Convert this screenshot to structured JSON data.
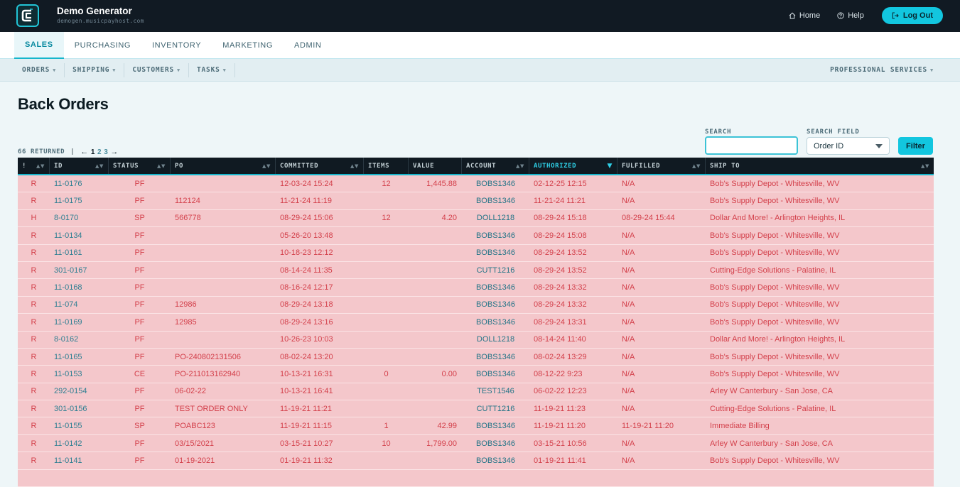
{
  "app": {
    "name": "Demo Generator",
    "host": "demogen.musicpayhost.com"
  },
  "topnav": {
    "home": "Home",
    "help": "Help",
    "logout": "Log Out"
  },
  "main_tabs": [
    "SALES",
    "PURCHASING",
    "INVENTORY",
    "MARKETING",
    "ADMIN"
  ],
  "active_tab": "SALES",
  "sub_nav": [
    "ORDERS",
    "SHIPPING",
    "CUSTOMERS",
    "TASKS"
  ],
  "sub_nav_right": "PROFESSIONAL SERVICES",
  "page_title": "Back Orders",
  "results": {
    "returned": "66 RETURNED",
    "pages": [
      "1",
      "2",
      "3"
    ],
    "current_page": "1"
  },
  "search": {
    "label": "SEARCH",
    "value": "",
    "field_label": "SEARCH FIELD",
    "field_value": "Order ID",
    "filter_button": "Filter"
  },
  "columns": [
    "!",
    "ID",
    "STATUS",
    "PO",
    "COMMITTED",
    "ITEMS",
    "VALUE",
    "ACCOUNT",
    "AUTHORIZED",
    "FULFILLED",
    "SHIP TO"
  ],
  "sorted_column": "AUTHORIZED",
  "colors": {
    "accent": "#12c6df",
    "row_bg": "#f4c7cb",
    "row_text": "#d3404b",
    "header_bg": "#101a22"
  },
  "rows": [
    {
      "flag": "R",
      "id": "11-0176",
      "status": "PF",
      "po": "",
      "committed": "12-03-24 15:24",
      "items": "12",
      "value": "1,445.88",
      "account": "BOBS1346",
      "authorized": "02-12-25 12:15",
      "fulfilled": "N/A",
      "ship_to": "Bob's Supply Depot - Whitesville, WV"
    },
    {
      "flag": "R",
      "id": "11-0175",
      "status": "PF",
      "po": "112124",
      "committed": "11-21-24 11:19",
      "items": "",
      "value": "",
      "account": "BOBS1346",
      "authorized": "11-21-24 11:21",
      "fulfilled": "N/A",
      "ship_to": "Bob's Supply Depot - Whitesville, WV"
    },
    {
      "flag": "H",
      "id": "8-0170",
      "status": "SP",
      "po": "566778",
      "committed": "08-29-24 15:06",
      "items": "12",
      "value": "4.20",
      "account": "DOLL1218",
      "authorized": "08-29-24 15:18",
      "fulfilled": "08-29-24 15:44",
      "ship_to": "Dollar And More! - Arlington Heights, IL"
    },
    {
      "flag": "R",
      "id": "11-0134",
      "status": "PF",
      "po": "",
      "committed": "05-26-20 13:48",
      "items": "",
      "value": "",
      "account": "BOBS1346",
      "authorized": "08-29-24 15:08",
      "fulfilled": "N/A",
      "ship_to": "Bob's Supply Depot - Whitesville, WV"
    },
    {
      "flag": "R",
      "id": "11-0161",
      "status": "PF",
      "po": "",
      "committed": "10-18-23 12:12",
      "items": "",
      "value": "",
      "account": "BOBS1346",
      "authorized": "08-29-24 13:52",
      "fulfilled": "N/A",
      "ship_to": "Bob's Supply Depot - Whitesville, WV"
    },
    {
      "flag": "R",
      "id": "301-0167",
      "status": "PF",
      "po": "",
      "committed": "08-14-24 11:35",
      "items": "",
      "value": "",
      "account": "CUTT1216",
      "authorized": "08-29-24 13:52",
      "fulfilled": "N/A",
      "ship_to": "Cutting-Edge Solutions - Palatine, IL"
    },
    {
      "flag": "R",
      "id": "11-0168",
      "status": "PF",
      "po": "",
      "committed": "08-16-24 12:17",
      "items": "",
      "value": "",
      "account": "BOBS1346",
      "authorized": "08-29-24 13:32",
      "fulfilled": "N/A",
      "ship_to": "Bob's Supply Depot - Whitesville, WV"
    },
    {
      "flag": "R",
      "id": "11-074",
      "status": "PF",
      "po": "12986",
      "committed": "08-29-24 13:18",
      "items": "",
      "value": "",
      "account": "BOBS1346",
      "authorized": "08-29-24 13:32",
      "fulfilled": "N/A",
      "ship_to": "Bob's Supply Depot - Whitesville, WV"
    },
    {
      "flag": "R",
      "id": "11-0169",
      "status": "PF",
      "po": "12985",
      "committed": "08-29-24 13:16",
      "items": "",
      "value": "",
      "account": "BOBS1346",
      "authorized": "08-29-24 13:31",
      "fulfilled": "N/A",
      "ship_to": "Bob's Supply Depot - Whitesville, WV"
    },
    {
      "flag": "R",
      "id": "8-0162",
      "status": "PF",
      "po": "",
      "committed": "10-26-23 10:03",
      "items": "",
      "value": "",
      "account": "DOLL1218",
      "authorized": "08-14-24 11:40",
      "fulfilled": "N/A",
      "ship_to": "Dollar And More! - Arlington Heights, IL"
    },
    {
      "flag": "R",
      "id": "11-0165",
      "status": "PF",
      "po": "PO-240802131506",
      "committed": "08-02-24 13:20",
      "items": "",
      "value": "",
      "account": "BOBS1346",
      "authorized": "08-02-24 13:29",
      "fulfilled": "N/A",
      "ship_to": "Bob's Supply Depot - Whitesville, WV"
    },
    {
      "flag": "R",
      "id": "11-0153",
      "status": "CE",
      "po": "PO-211013162940",
      "committed": "10-13-21 16:31",
      "items": "0",
      "value": "0.00",
      "account": "BOBS1346",
      "authorized": "08-12-22 9:23",
      "fulfilled": "N/A",
      "ship_to": "Bob's Supply Depot - Whitesville, WV"
    },
    {
      "flag": "R",
      "id": "292-0154",
      "status": "PF",
      "po": "06-02-22",
      "committed": "10-13-21 16:41",
      "items": "",
      "value": "",
      "account": "TEST1546",
      "authorized": "06-02-22 12:23",
      "fulfilled": "N/A",
      "ship_to": "Arley W Canterbury - San Jose, CA"
    },
    {
      "flag": "R",
      "id": "301-0156",
      "status": "PF",
      "po": "TEST ORDER ONLY",
      "committed": "11-19-21 11:21",
      "items": "",
      "value": "",
      "account": "CUTT1216",
      "authorized": "11-19-21 11:23",
      "fulfilled": "N/A",
      "ship_to": "Cutting-Edge Solutions - Palatine, IL"
    },
    {
      "flag": "R",
      "id": "11-0155",
      "status": "SP",
      "po": "POABC123",
      "committed": "11-19-21 11:15",
      "items": "1",
      "value": "42.99",
      "account": "BOBS1346",
      "authorized": "11-19-21 11:20",
      "fulfilled": "11-19-21 11:20",
      "ship_to": "Immediate Billing"
    },
    {
      "flag": "R",
      "id": "11-0142",
      "status": "PF",
      "po": "03/15/2021",
      "committed": "03-15-21 10:27",
      "items": "10",
      "value": "1,799.00",
      "account": "BOBS1346",
      "authorized": "03-15-21 10:56",
      "fulfilled": "N/A",
      "ship_to": "Arley W Canterbury - San Jose, CA"
    },
    {
      "flag": "R",
      "id": "11-0141",
      "status": "PF",
      "po": "01-19-2021",
      "committed": "01-19-21 11:32",
      "items": "",
      "value": "",
      "account": "BOBS1346",
      "authorized": "01-19-21 11:41",
      "fulfilled": "N/A",
      "ship_to": "Bob's Supply Depot - Whitesville, WV"
    },
    {
      "flag": "",
      "id": "",
      "status": "",
      "po": "",
      "committed": "",
      "items": "",
      "value": "",
      "account": "",
      "authorized": "",
      "fulfilled": "",
      "ship_to": ""
    }
  ]
}
